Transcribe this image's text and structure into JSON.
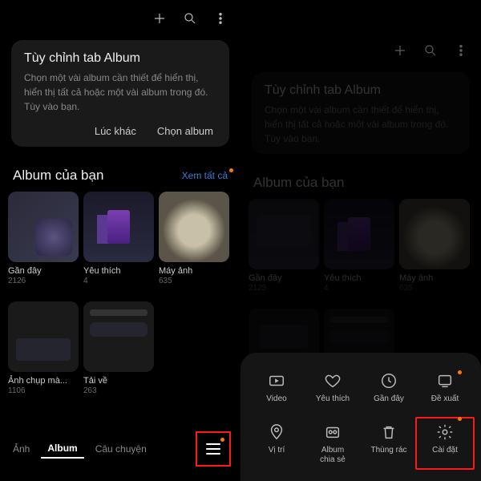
{
  "top_icons": {
    "plus": "plus",
    "search": "search",
    "more": "more"
  },
  "card": {
    "title": "Tùy chỉnh tab Album",
    "body": "Chọn một vài album cần thiết để hiển thị, hiển thị tất cả hoặc một vài album trong đó. Tùy vào bạn.",
    "later": "Lúc khác",
    "choose": "Chọn album"
  },
  "section_title": "Album của bạn",
  "see_all": "Xem tất cả",
  "albums_left": [
    {
      "title": "Gần đây",
      "count": "2126"
    },
    {
      "title": "Yêu thích",
      "count": "4"
    },
    {
      "title": "Máy ảnh",
      "count": "635"
    },
    {
      "title": "Ảnh chụp mà...",
      "count": "1106"
    },
    {
      "title": "Tải về",
      "count": "263"
    }
  ],
  "albums_right": [
    {
      "title": "Gần đây",
      "count": "2125"
    },
    {
      "title": "Yêu thích",
      "count": "4"
    },
    {
      "title": "Máy ảnh",
      "count": "635"
    }
  ],
  "tabs": {
    "photos": "Ảnh",
    "album": "Album",
    "stories": "Câu chuyện"
  },
  "sheet": {
    "video": "Video",
    "favorite": "Yêu thích",
    "recent": "Gần đây",
    "suggest": "Đề xuất",
    "location": "Vị trí",
    "shared": "Album\nchia sẻ",
    "trash": "Thùng rác",
    "settings": "Cài đặt"
  }
}
